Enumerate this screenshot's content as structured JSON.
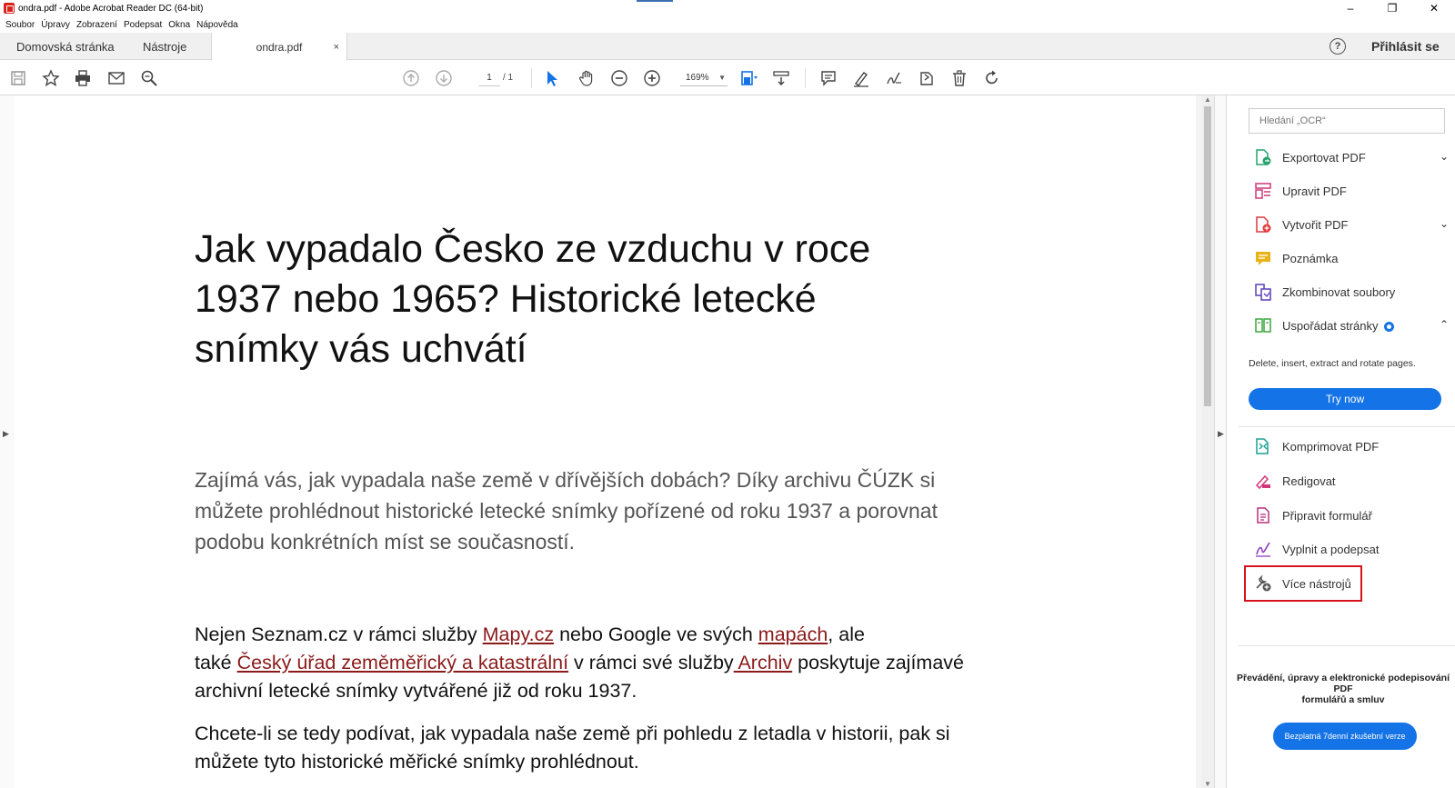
{
  "window": {
    "title": "ondra.pdf - Adobe Acrobat Reader DC (64-bit)",
    "minimize": "–",
    "restore": "❐",
    "close": "✕"
  },
  "menu": [
    "Soubor",
    "Úpravy",
    "Zobrazení",
    "Podepsat",
    "Okna",
    "Nápověda"
  ],
  "tabs": {
    "home": "Domovská stránka",
    "tools": "Nástroje",
    "document": "ondra.pdf",
    "close": "×"
  },
  "account": {
    "help": "?",
    "signin": "Přihlásit se"
  },
  "toolbar": {
    "page_current": "1",
    "page_total": "/ 1",
    "zoom": "169%",
    "icons": [
      "save-icon",
      "bookmark-star-icon",
      "print-icon",
      "email-icon",
      "search-zoom-icon",
      "previous-page-icon",
      "next-page-icon",
      "select-cursor-icon",
      "hand-icon",
      "zoom-out-icon",
      "zoom-in-icon",
      "fit-page-icon",
      "scroll-mode-icon",
      "comment-icon",
      "highlight-pen-icon",
      "sign-icon",
      "share-icon",
      "delete-icon",
      "rotate-icon"
    ]
  },
  "document": {
    "heading": [
      "Jak vypadalo Česko ze vzduchu v roce",
      "1937 nebo 1965? Historické letecké",
      "snímky vás uchvátí"
    ],
    "intro": [
      "Zajímá vás, jak vypadala naše země v dřívějších dobách? Díky archivu ČÚZK si",
      "můžete prohlédnout historické letecké snímky pořízené od roku 1937 a porovnat",
      "podobu konkrétních míst se současností."
    ],
    "para1": {
      "t1": "Nejen Seznam.cz v rámci služby ",
      "link1": "Mapy.cz",
      "t2": " nebo Google ve svých ",
      "link2": "mapách",
      "t3": ", ale",
      "t4": "také ",
      "link3": "Český úřad zeměměřický a katastrální",
      "t5": " v rámci své služby",
      "link4": " Archiv",
      "t6": " poskytuje zajímavé",
      "t7": "archivní letecké snímky vytvářené již od roku 1937."
    },
    "para2": [
      "Chcete-li se tedy podívat, jak vypadala naše země při pohledu z letadla v historii, pak si",
      "můžete tyto historické měřické snímky prohlédnout."
    ]
  },
  "panel": {
    "search_placeholder": "Hledání „OCR“",
    "tools": [
      {
        "label": "Exportovat PDF",
        "icon": "export-pdf-icon",
        "color": "#27a36b"
      },
      {
        "label": "Upravit PDF",
        "icon": "edit-pdf-icon",
        "color": "#d1357a"
      },
      {
        "label": "Vytvořit PDF",
        "icon": "create-pdf-icon",
        "color": "#e0393e"
      },
      {
        "label": "Poznámka",
        "icon": "comment-note-icon",
        "color": "#e8b318"
      },
      {
        "label": "Zkombinovat soubory",
        "icon": "combine-files-icon",
        "color": "#5a3fc0"
      },
      {
        "label": "Uspořádat stránky",
        "icon": "organize-pages-icon",
        "color": "#3da63b"
      },
      {
        "label": "Komprimovat PDF",
        "icon": "compress-pdf-icon",
        "color": "#1aa092"
      },
      {
        "label": "Redigovat",
        "icon": "redact-icon",
        "color": "#d1357a"
      },
      {
        "label": "Připravit formulář",
        "icon": "prepare-form-icon",
        "color": "#b9307e"
      },
      {
        "label": "Vyplnit a podepsat",
        "icon": "fill-sign-icon",
        "color": "#8f3fbf"
      },
      {
        "label": "Více nástrojů",
        "icon": "more-tools-icon",
        "color": "#555555"
      }
    ],
    "chevron_down": "⌄",
    "chevron_up": "⌃",
    "organize_desc": "Delete, insert, extract and rotate pages.",
    "try_now": "Try now",
    "promo_line1": "Převádění, úpravy a elektronické podepisování PDF",
    "promo_line2": "formulářů a smluv",
    "trial_button": "Bezplatná 7denní zkušební verze"
  }
}
